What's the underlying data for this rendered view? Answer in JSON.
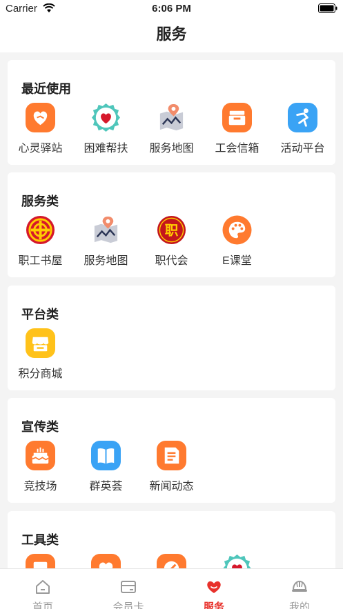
{
  "status_bar": {
    "carrier": "Carrier",
    "time": "6:06 PM"
  },
  "header": {
    "title": "服务"
  },
  "sections": [
    {
      "title": "最近使用",
      "items": [
        {
          "label": "心灵驿站",
          "icon": "heart-hands-icon"
        },
        {
          "label": "困难帮扶",
          "icon": "heart-badge-icon"
        },
        {
          "label": "服务地图",
          "icon": "map-pin-icon"
        },
        {
          "label": "工会信箱",
          "icon": "mailbox-icon"
        },
        {
          "label": "活动平台",
          "icon": "running-figure-icon"
        }
      ]
    },
    {
      "title": "服务类",
      "items": [
        {
          "label": "职工书屋",
          "icon": "union-emblem-icon"
        },
        {
          "label": "服务地图",
          "icon": "map-pin-icon"
        },
        {
          "label": "职代会",
          "icon": "zhi-seal-icon",
          "glyph": "职"
        },
        {
          "label": "E课堂",
          "icon": "palette-icon"
        }
      ]
    },
    {
      "title": "平台类",
      "items": [
        {
          "label": "积分商城",
          "icon": "shop-icon"
        }
      ]
    },
    {
      "title": "宣传类",
      "items": [
        {
          "label": "竞技场",
          "icon": "trophy-icon"
        },
        {
          "label": "群英荟",
          "icon": "open-book-icon"
        },
        {
          "label": "新闻动态",
          "icon": "news-document-icon"
        }
      ]
    },
    {
      "title": "工具类",
      "items": []
    }
  ],
  "tab_bar": [
    {
      "label": "首页",
      "icon": "home-icon"
    },
    {
      "label": "会员卡",
      "icon": "card-icon"
    },
    {
      "label": "服务",
      "icon": "heart-service-icon"
    },
    {
      "label": "我的",
      "icon": "helmet-icon"
    }
  ],
  "colors": {
    "accent": "#e8322c",
    "orange": "#ff7a2f",
    "blue": "#3aa3f5",
    "yellow": "#ffc21a",
    "teal": "#4fc6bb"
  }
}
